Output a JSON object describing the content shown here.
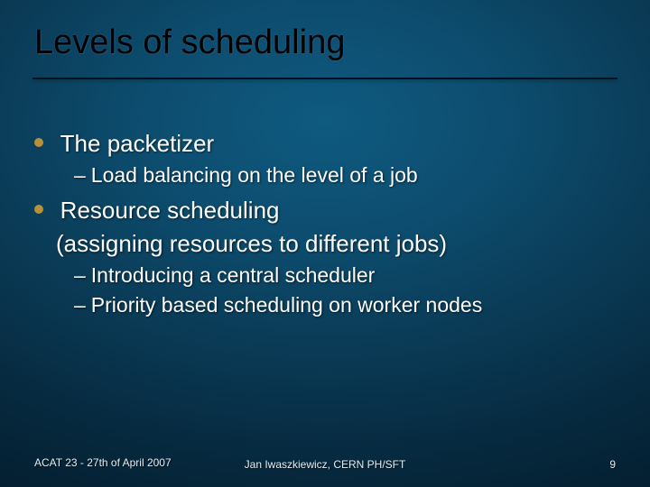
{
  "title": "Levels of scheduling",
  "bullets": [
    {
      "text": "The packetizer",
      "continuation": null,
      "sub": [
        "Load balancing on the level of a job"
      ]
    },
    {
      "text": "Resource scheduling",
      "continuation": "(assigning resources to different jobs)",
      "sub": [
        "Introducing a central scheduler",
        "Priority based scheduling on worker nodes"
      ]
    }
  ],
  "footer": {
    "left": "ACAT 23 - 27th of April 2007",
    "center": "Jan Iwaszkiewicz, CERN PH/SFT",
    "right": "9"
  }
}
